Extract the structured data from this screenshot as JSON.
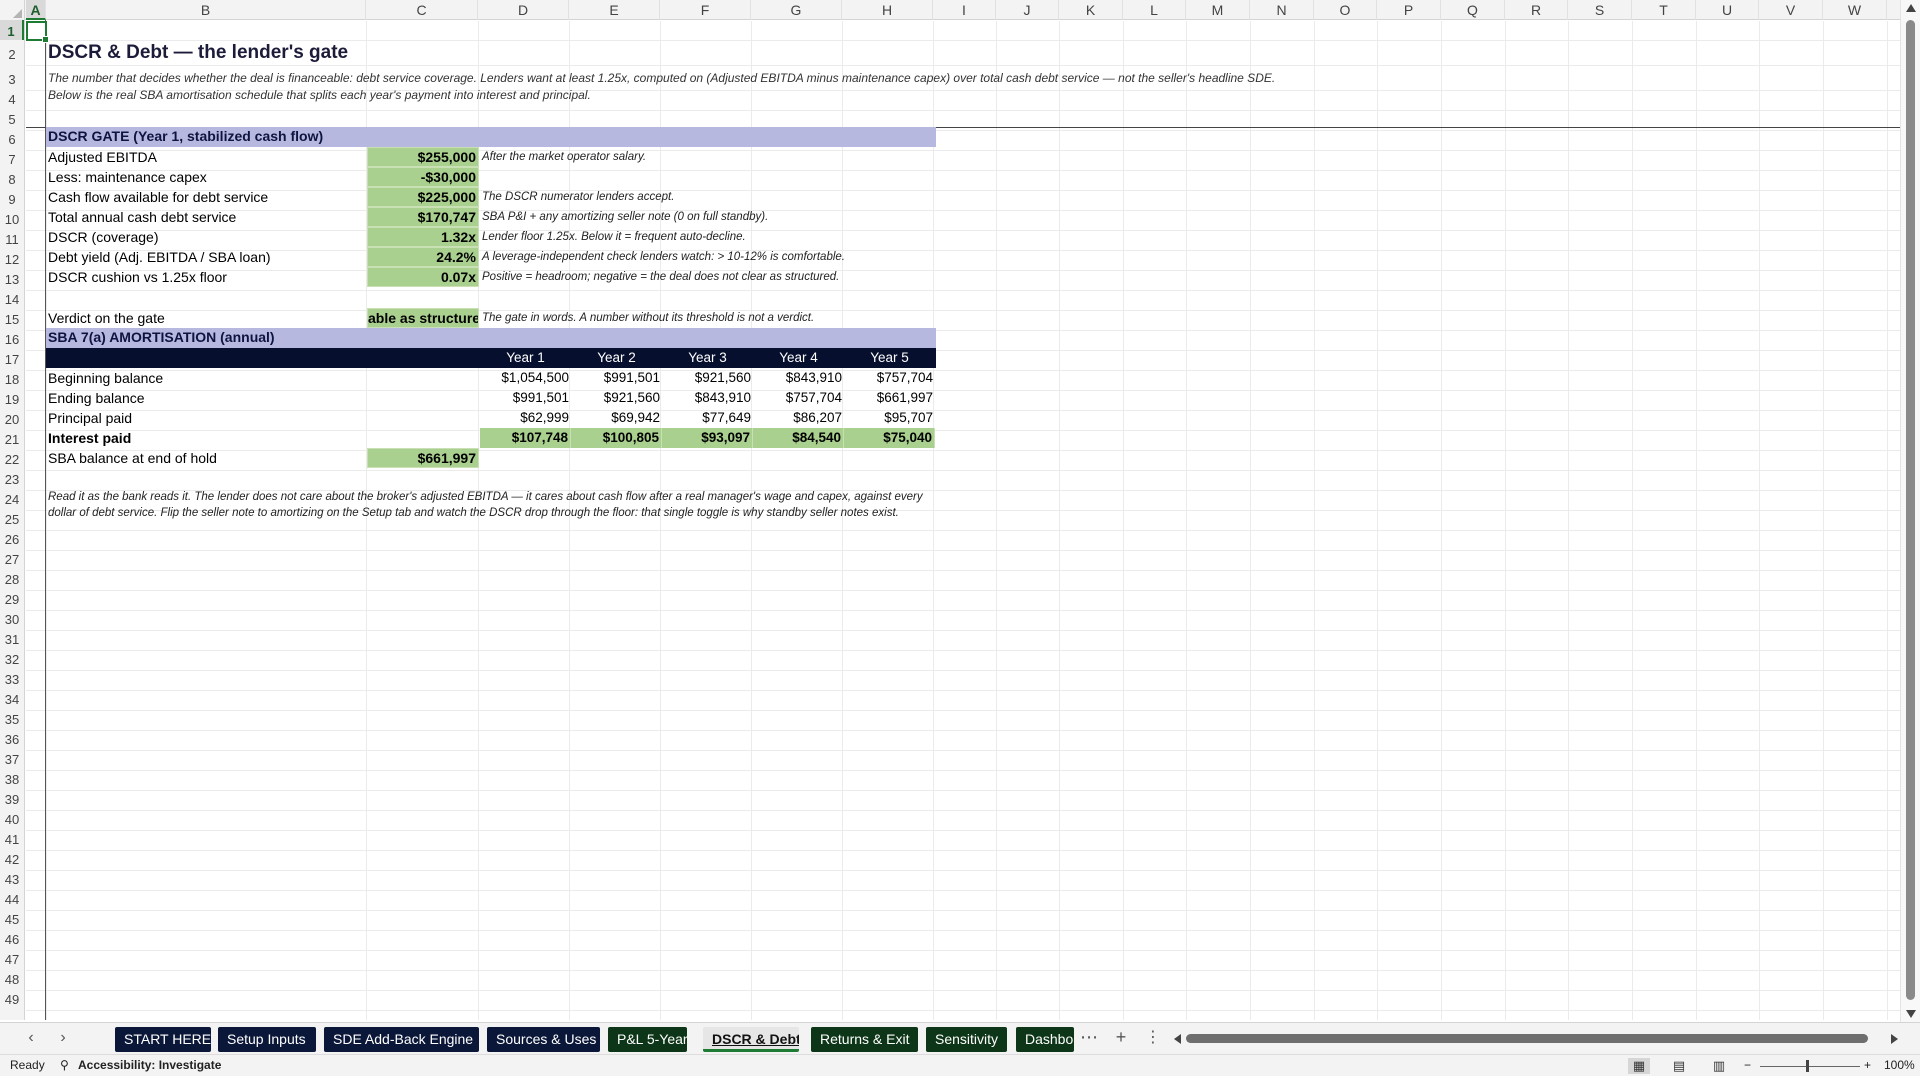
{
  "columns": [
    "A",
    "B",
    "C",
    "D",
    "E",
    "F",
    "G",
    "H",
    "I",
    "J",
    "K",
    "L",
    "M",
    "N",
    "O",
    "P",
    "Q",
    "R",
    "S",
    "T",
    "U",
    "V",
    "W"
  ],
  "rows": [
    "1",
    "2",
    "3",
    "4",
    "5",
    "6",
    "7",
    "8",
    "9",
    "10",
    "11",
    "12",
    "13",
    "14",
    "15",
    "16",
    "17",
    "18",
    "19",
    "20",
    "21",
    "22",
    "23",
    "24",
    "25",
    "26",
    "27",
    "28",
    "29",
    "30",
    "31",
    "32",
    "33",
    "34",
    "35",
    "36",
    "37",
    "38",
    "39",
    "40",
    "41",
    "42",
    "43",
    "44",
    "45",
    "46",
    "47",
    "48",
    "49"
  ],
  "sheet": {
    "title": "DSCR & Debt — the lender's gate",
    "subtitle": "The number that decides whether the deal is financeable: debt service coverage. Lenders want at least 1.25x, computed on (Adjusted EBITDA minus maintenance capex) over total cash debt service — not the seller's headline SDE. Below is the real SBA amortisation schedule that splits each year's payment into interest and principal.",
    "dscr_section": {
      "header": "DSCR GATE (Year 1, stabilized cash flow)",
      "rows": [
        {
          "label": "Adjusted EBITDA",
          "value": "$255,000",
          "note": "After the market operator salary."
        },
        {
          "label": "Less: maintenance capex",
          "value": "-$30,000",
          "note": ""
        },
        {
          "label": "Cash flow available for debt service",
          "value": "$225,000",
          "note": "The DSCR numerator lenders accept."
        },
        {
          "label": "Total annual cash debt service",
          "value": "$170,747",
          "note": "SBA P&I + any amortizing seller note (0 on full standby)."
        },
        {
          "label": "DSCR (coverage)",
          "value": "1.32x",
          "note": "Lender floor 1.25x. Below it = frequent auto-decline."
        },
        {
          "label": "Debt yield (Adj. EBITDA / SBA loan)",
          "value": "24.2%",
          "note": "A leverage-independent check lenders watch: > 10-12% is comfortable."
        },
        {
          "label": "DSCR cushion vs 1.25x floor",
          "value": "0.07x",
          "note": "Positive = headroom; negative = the deal does not clear as structured."
        }
      ],
      "verdict_label": "Verdict on the gate",
      "verdict_value": "able as structured",
      "verdict_note": "The gate in words. A number without its threshold is not a verdict."
    },
    "amort_section": {
      "header": "SBA 7(a) AMORTISATION (annual)",
      "years": [
        "Year 1",
        "Year 2",
        "Year 3",
        "Year 4",
        "Year 5"
      ],
      "rows": [
        {
          "label": "Beginning balance",
          "bold": false,
          "values": [
            "$1,054,500",
            "$991,501",
            "$921,560",
            "$843,910",
            "$757,704"
          ]
        },
        {
          "label": "Ending balance",
          "bold": false,
          "values": [
            "$991,501",
            "$921,560",
            "$843,910",
            "$757,704",
            "$661,997"
          ]
        },
        {
          "label": "Principal paid",
          "bold": false,
          "values": [
            "$62,999",
            "$69,942",
            "$77,649",
            "$86,207",
            "$95,707"
          ]
        },
        {
          "label": "Interest paid",
          "bold": true,
          "values": [
            "$107,748",
            "$100,805",
            "$93,097",
            "$84,540",
            "$75,040"
          ]
        }
      ],
      "end_balance_label": "SBA balance at end of hold",
      "end_balance_value": "$661,997"
    },
    "footnote": "Read it as the bank reads it. The lender does not care about the broker's adjusted EBITDA — it cares about cash flow after a real manager's wage and capex, against every dollar of debt service. Flip the seller note to amortizing on the Setup tab and watch the DSCR drop through the floor: that single toggle is why standby seller notes exist."
  },
  "tabs": [
    {
      "label": "START HERE",
      "style": "navy"
    },
    {
      "label": "Setup Inputs",
      "style": "navy"
    },
    {
      "label": "SDE Add-Back Engine",
      "style": "navy"
    },
    {
      "label": "Sources & Uses",
      "style": "navy"
    },
    {
      "label": "P&L 5-Year",
      "style": "green"
    },
    {
      "label": "DSCR & Debt",
      "style": "active"
    },
    {
      "label": "Returns & Exit",
      "style": "green"
    },
    {
      "label": "Sensitivity",
      "style": "green"
    },
    {
      "label": "Dashbo",
      "style": "green"
    }
  ],
  "status": {
    "ready": "Ready",
    "accessibility": "Accessibility: Investigate",
    "zoom": "100%"
  },
  "icons": {
    "prev_sheet": "chevron-left-icon",
    "next_sheet": "chevron-right-icon",
    "more_sheets": "ellipsis-icon",
    "add_sheet": "plus-icon",
    "options": "vertical-ellipsis-icon"
  },
  "colors": {
    "section_header": "#b7b8e0",
    "value_fill": "#a9d08e",
    "navy_band": "#070f2e",
    "active_accent": "#1e7b34"
  }
}
